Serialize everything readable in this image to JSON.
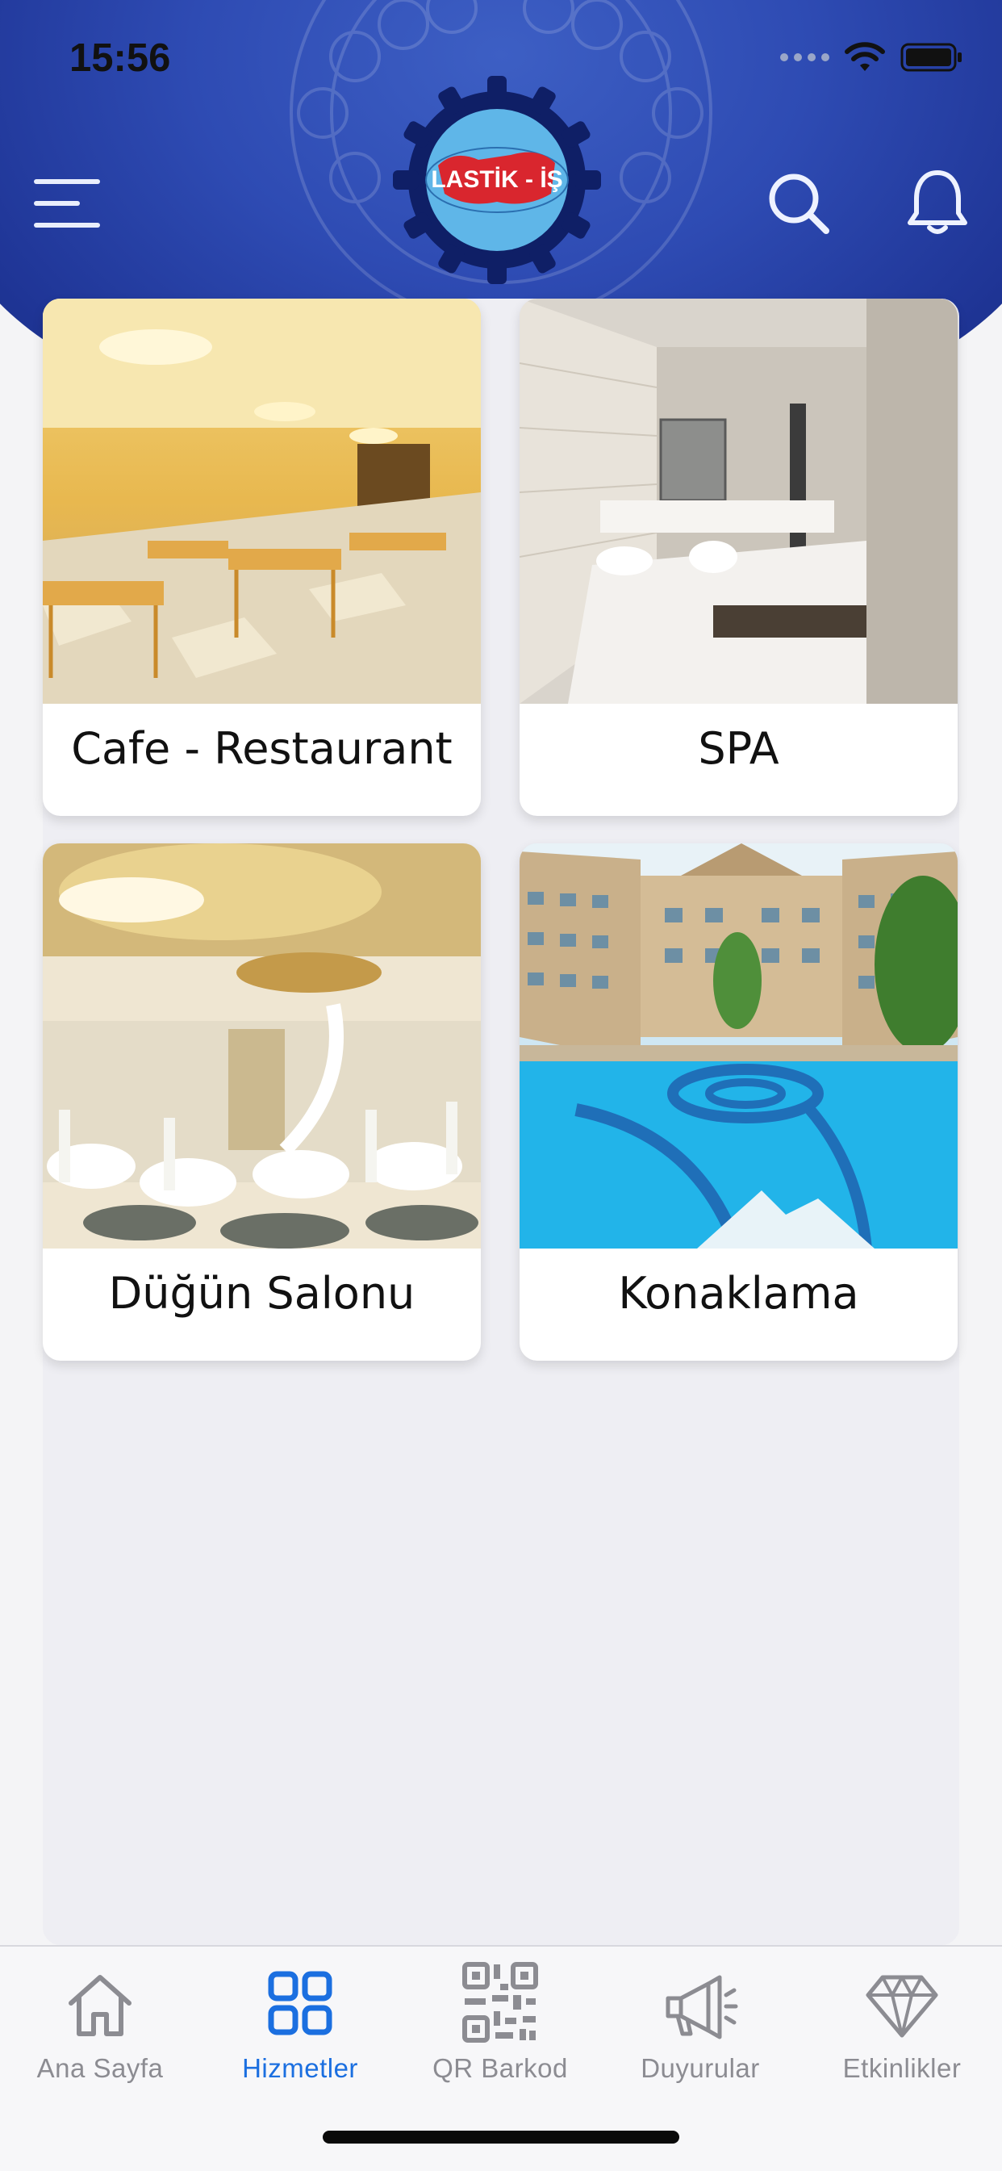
{
  "status_bar": {
    "time": "15:56"
  },
  "header": {
    "logo_text": "LASTİK - İŞ",
    "menu_icon": "hamburger-menu-icon",
    "search_icon": "search-icon",
    "bell_icon": "bell-icon",
    "brand_color": "#2e4bb3"
  },
  "services": [
    {
      "label": "Cafe - Restaurant",
      "image": "restaurant-photo"
    },
    {
      "label": "SPA",
      "image": "spa-photo"
    },
    {
      "label": "Düğün Salonu",
      "image": "wedding-hall-photo"
    },
    {
      "label": "Konaklama",
      "image": "hotel-pool-photo"
    }
  ],
  "tabbar": {
    "active_color": "#1b6fe0",
    "inactive_color": "#8c8c92",
    "tabs": [
      {
        "label": "Ana Sayfa",
        "icon": "home-icon",
        "active": false
      },
      {
        "label": "Hizmetler",
        "icon": "grid-icon",
        "active": true
      },
      {
        "label": "QR Barkod",
        "icon": "qr-code-icon",
        "active": false
      },
      {
        "label": "Duyurular",
        "icon": "megaphone-icon",
        "active": false
      },
      {
        "label": "Etkinlikler",
        "icon": "diamond-icon",
        "active": false
      }
    ]
  }
}
